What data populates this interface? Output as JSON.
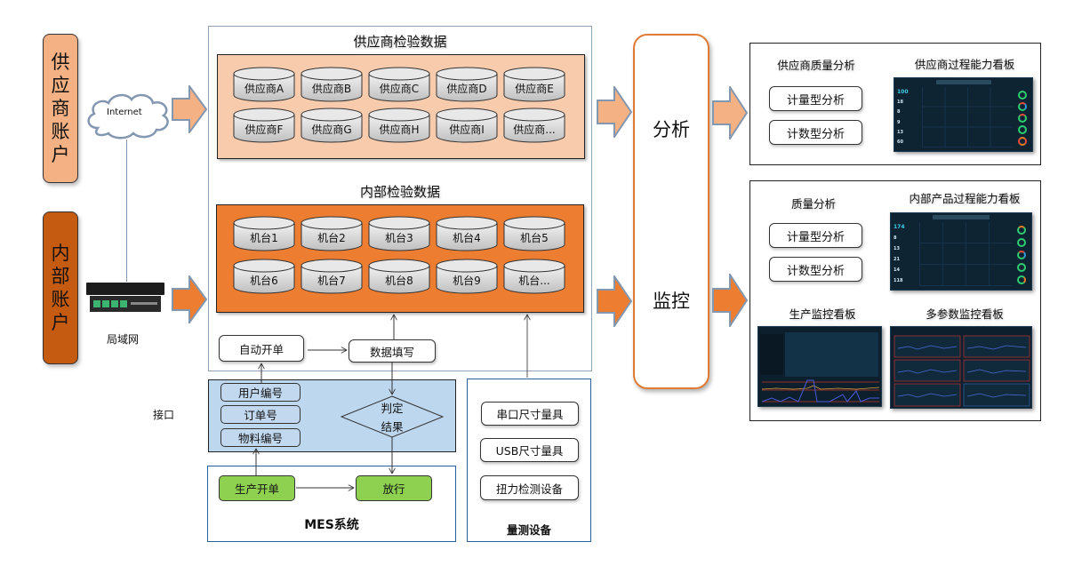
{
  "accounts": {
    "supplier": {
      "label_chars": [
        "供",
        "应",
        "商",
        "账",
        "户"
      ],
      "color": "#f4b183"
    },
    "internal": {
      "label_chars": [
        "内",
        "部",
        "账",
        "户"
      ],
      "color": "#c55a11"
    }
  },
  "network": {
    "internet_label": "Internet",
    "lan_label": "局域网"
  },
  "supplier_data": {
    "title": "供应商检验数据",
    "panel_color": "#f8cbad",
    "databases": [
      "供应商A",
      "供应商B",
      "供应商C",
      "供应商D",
      "供应商E",
      "供应商F",
      "供应商G",
      "供应商H",
      "供应商I",
      "供应商..."
    ]
  },
  "internal_data": {
    "title": "内部检验数据",
    "panel_color": "#ed7d31",
    "databases": [
      "机台1",
      "机台2",
      "机台3",
      "机台4",
      "机台5",
      "机台6",
      "机台7",
      "机台8",
      "机台9",
      "机台..."
    ]
  },
  "flow": {
    "auto_order": "自动开单",
    "data_fill": "数据填写",
    "interface_label": "接口",
    "interface_fields": [
      "用户编号",
      "订单号",
      "物料编号"
    ],
    "judgement": [
      "判定",
      "结果"
    ],
    "mes": {
      "production_order": "生产开单",
      "release": "放行",
      "title": "MES系统"
    },
    "measurement": {
      "devices": [
        "串口尺寸量具",
        "USB尺寸量具",
        "扭力检测设备"
      ],
      "title": "量测设备"
    }
  },
  "middle": {
    "analysis": "分析",
    "monitor": "监控"
  },
  "right": {
    "supplier_panel": {
      "quality_title": "供应商质量分析",
      "buttons": [
        "计量型分析",
        "计数型分析"
      ],
      "board_title": "供应商过程能力看板",
      "board_numbers": [
        "100",
        "18",
        "8",
        "9",
        "13",
        "60"
      ]
    },
    "internal_panel": {
      "quality_title": "质量分析",
      "buttons": [
        "计量型分析",
        "计数型分析"
      ],
      "board_title": "内部产品过程能力看板",
      "board_numbers": [
        "174",
        "8",
        "13",
        "21",
        "14",
        "118"
      ],
      "production_board_title": "生产监控看板",
      "multi_param_board_title": "多参数监控看板"
    }
  },
  "colors": {
    "light_orange": "#f4b183",
    "dark_orange": "#ed7d31",
    "interface_blue": "#bdd7ee",
    "mes_green": "#8ed04f",
    "arrow_border": "#8497b0"
  }
}
